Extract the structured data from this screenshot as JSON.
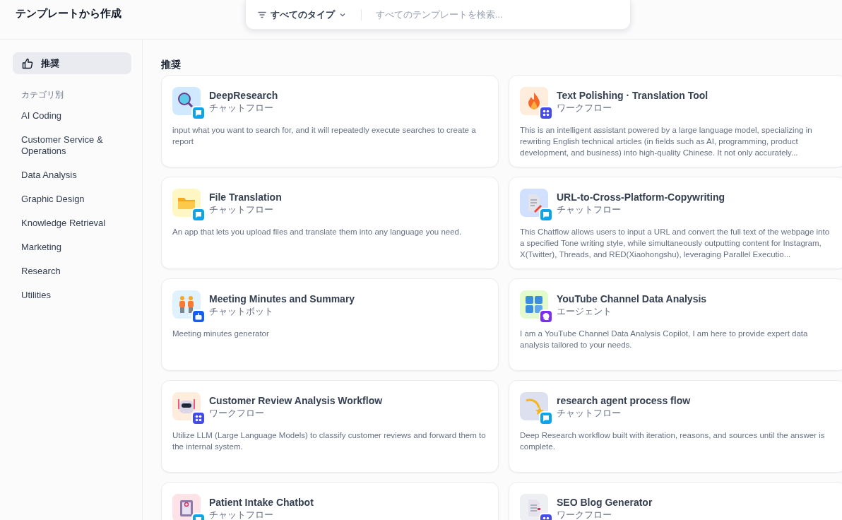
{
  "header": {
    "title": "テンプレートから作成",
    "type_filter": "すべてのタイプ",
    "search": {
      "placeholder": "すべてのテンプレートを検索..."
    }
  },
  "sidebar": {
    "recommended": {
      "label": "推奨",
      "selected": true
    },
    "section_label": "カテゴリ別",
    "categories": [
      {
        "label": "AI Coding",
        "selected": false
      },
      {
        "label": "Customer Service & Operations",
        "selected": false
      },
      {
        "label": "Data Analysis",
        "selected": false
      },
      {
        "label": "Graphic Design",
        "selected": false
      },
      {
        "label": "Knowledge Retrieval",
        "selected": false
      },
      {
        "label": "Marketing",
        "selected": false
      },
      {
        "label": "Research",
        "selected": false
      },
      {
        "label": "Utilities",
        "selected": false
      }
    ]
  },
  "section_title": "推奨",
  "cards": [
    {
      "title": "DeepResearch",
      "type": "チャットフロー",
      "kind": "chatflow",
      "color": "#d1e9ff",
      "description": "input what you want to search for, and it will repeatedly execute searches to create a report"
    },
    {
      "title": "Text Polishing · Translation Tool",
      "type": "ワークフロー",
      "kind": "workflow",
      "color": "#feecdc",
      "description": "This is an intelligent assistant powered by a large language model, specializing in rewriting English technical articles (in fields such as AI, programming, product development, and business) into high-quality Chinese. It not only accurately..."
    },
    {
      "title": "File Translation",
      "type": "チャットフロー",
      "kind": "chatflow",
      "color": "#fef7c3",
      "description": "An app that lets you upload files and translate them into any language you need."
    },
    {
      "title": "URL-to-Cross-Platform-Copywriting",
      "type": "チャットフロー",
      "kind": "chatflow",
      "color": "#d1e0ff",
      "description": "This Chatflow allows users to input a URL and convert the full text of the webpage into a specified Tone writing style, while simultaneously outputting content for Instagram, X(Twitter), Threads, and RED(Xiaohongshu), leveraging Parallel Executio..."
    },
    {
      "title": "Meeting Minutes and Summary",
      "type": "チャットボット",
      "kind": "chatbot",
      "color": "#e0f2fe",
      "description": "Meeting minutes generator"
    },
    {
      "title": "YouTube Channel Data Analysis",
      "type": "エージェント",
      "kind": "agent",
      "color": "#e3fbcc",
      "description": "I am a YouTube Channel Data Analysis Copilot, I am here to provide expert data analysis tailored to your needs."
    },
    {
      "title": "Customer Review Analysis Workflow",
      "type": "ワークフロー",
      "kind": "workflow",
      "color": "#feecdc",
      "description": "Utilize LLM (Large Language Models) to classify customer reviews and forward them to the internal system."
    },
    {
      "title": "research agent process flow",
      "type": "チャットフロー",
      "kind": "chatflow",
      "color": "#dde0ef",
      "description": "Deep Research workflow built with iteration, reasons, and sources until the answer is complete."
    },
    {
      "title": "Patient Intake Chatbot",
      "type": "チャットフロー",
      "kind": "chatflow",
      "color": "#fde2e8"
    },
    {
      "title": "SEO Blog Generator",
      "type": "ワークフロー",
      "kind": "workflow",
      "color": "#eeeff3"
    }
  ]
}
